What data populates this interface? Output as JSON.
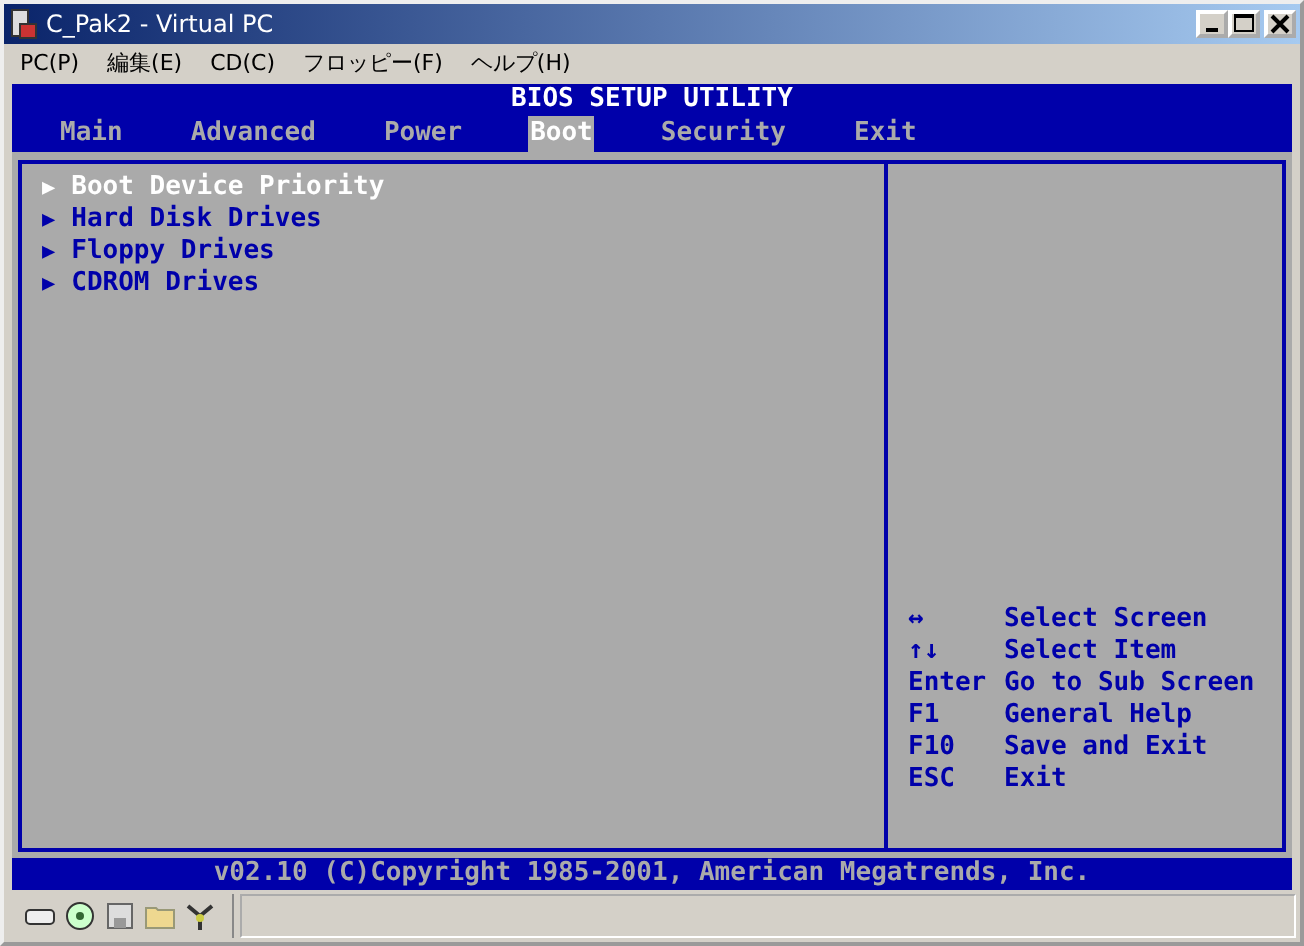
{
  "window": {
    "title": "C_Pak2 - Virtual PC"
  },
  "menu": [
    "PC(P)",
    "編集(E)",
    "CD(C)",
    "フロッピー(F)",
    "ヘルプ(H)"
  ],
  "bios": {
    "title": "BIOS SETUP UTILITY",
    "tabs": [
      {
        "label": "Main",
        "selected": false
      },
      {
        "label": "Advanced",
        "selected": false
      },
      {
        "label": "Power",
        "selected": false
      },
      {
        "label": "Boot",
        "selected": true
      },
      {
        "label": "Security",
        "selected": false
      },
      {
        "label": "Exit",
        "selected": false
      }
    ],
    "items": [
      {
        "marker": "▶",
        "label": "Boot Device Priority",
        "selected": true
      },
      {
        "marker": "▶",
        "label": "Hard Disk Drives",
        "selected": false
      },
      {
        "marker": "▶",
        "label": "Floppy Drives",
        "selected": false
      },
      {
        "marker": "▶",
        "label": "CDROM Drives",
        "selected": false
      }
    ],
    "help": [
      {
        "key": "↔",
        "action": "Select Screen"
      },
      {
        "key": "↑↓",
        "action": "Select Item"
      },
      {
        "key": "Enter",
        "action": "Go to Sub Screen"
      },
      {
        "key": "F1",
        "action": "General Help"
      },
      {
        "key": "F10",
        "action": "Save and Exit"
      },
      {
        "key": "ESC",
        "action": "Exit"
      }
    ],
    "footer": "v02.10 (C)Copyright 1985-2001, American Megatrends, Inc."
  }
}
